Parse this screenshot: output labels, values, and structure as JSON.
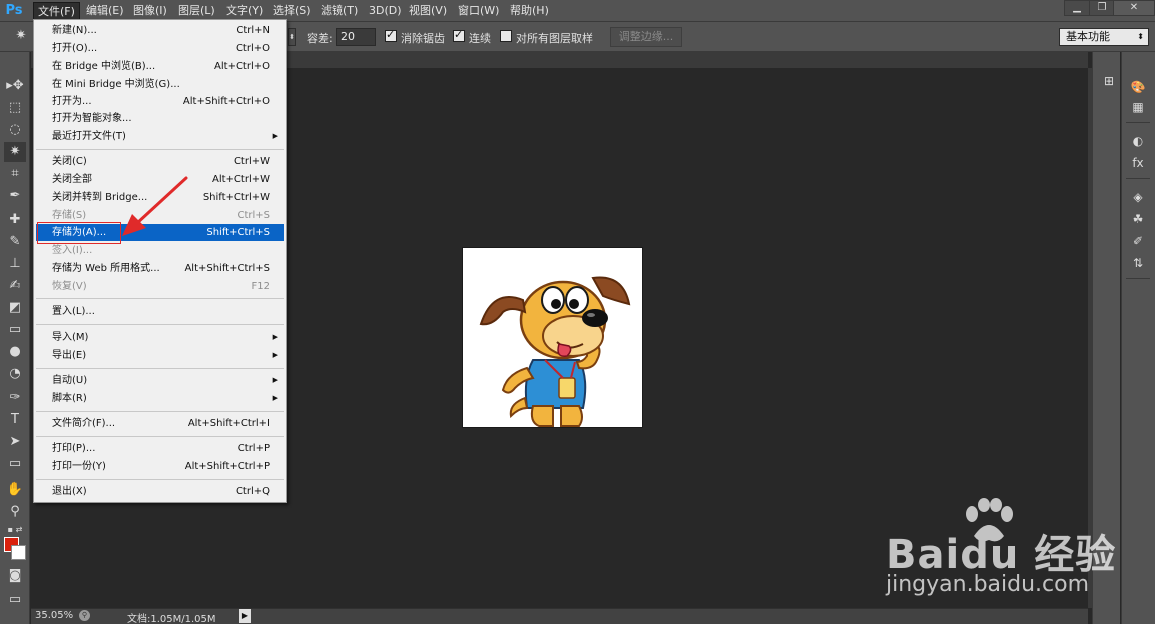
{
  "app": {
    "logo": "Ps"
  },
  "menubar": {
    "items": [
      "文件(F)",
      "编辑(E)",
      "图像(I)",
      "图层(L)",
      "文字(Y)",
      "选择(S)",
      "滤镜(T)",
      "3D(D)",
      "视图(V)",
      "窗口(W)",
      "帮助(H)"
    ],
    "active_index": 0,
    "window_controls": {
      "minimize": "▁",
      "restore": "❐",
      "close": "✕"
    }
  },
  "options": {
    "tolerance_label": "容差:",
    "tolerance_value": "20",
    "antialias_label": "消除锯齿",
    "antialias_checked": true,
    "contiguous_label": "连续",
    "contiguous_checked": true,
    "sample_all_layers_label": "对所有图层取样",
    "sample_all_layers_checked": false,
    "refine_edge_button": "调整边缘...",
    "workspace": "基本功能"
  },
  "file_menu": {
    "items": [
      {
        "label": "新建(N)...",
        "shortcut": "Ctrl+N"
      },
      {
        "label": "打开(O)...",
        "shortcut": "Ctrl+O"
      },
      {
        "label": "在 Bridge 中浏览(B)...",
        "shortcut": "Alt+Ctrl+O"
      },
      {
        "label": "在 Mini Bridge 中浏览(G)...",
        "shortcut": ""
      },
      {
        "label": "打开为...",
        "shortcut": "Alt+Shift+Ctrl+O"
      },
      {
        "label": "打开为智能对象...",
        "shortcut": ""
      },
      {
        "label": "最近打开文件(T)",
        "shortcut": "",
        "submenu": true
      },
      {
        "label": "关闭(C)",
        "shortcut": "Ctrl+W"
      },
      {
        "label": "关闭全部",
        "shortcut": "Alt+Ctrl+W"
      },
      {
        "label": "关闭并转到 Bridge...",
        "shortcut": "Shift+Ctrl+W"
      },
      {
        "label": "存储(S)",
        "shortcut": "Ctrl+S",
        "disabled": true
      },
      {
        "label": "存储为(A)...",
        "shortcut": "Shift+Ctrl+S",
        "highlighted": true
      },
      {
        "label": "签入(I)...",
        "shortcut": "",
        "disabled": true
      },
      {
        "label": "存储为 Web 所用格式...",
        "shortcut": "Alt+Shift+Ctrl+S"
      },
      {
        "label": "恢复(V)",
        "shortcut": "F12",
        "disabled": true
      },
      {
        "label": "置入(L)...",
        "shortcut": ""
      },
      {
        "label": "导入(M)",
        "shortcut": "",
        "submenu": true
      },
      {
        "label": "导出(E)",
        "shortcut": "",
        "submenu": true
      },
      {
        "label": "自动(U)",
        "shortcut": "",
        "submenu": true
      },
      {
        "label": "脚本(R)",
        "shortcut": "",
        "submenu": true
      },
      {
        "label": "文件简介(F)...",
        "shortcut": "Alt+Shift+Ctrl+I"
      },
      {
        "label": "打印(P)...",
        "shortcut": "Ctrl+P"
      },
      {
        "label": "打印一份(Y)",
        "shortcut": "Alt+Shift+Ctrl+P"
      },
      {
        "label": "退出(X)",
        "shortcut": "Ctrl+Q"
      }
    ]
  },
  "status": {
    "zoom": "35.05%",
    "doc_info": "文档:1.05M/1.05M"
  },
  "colors": {
    "foreground": "#d9210d",
    "background": "#ffffff",
    "highlight": "#0a64c6",
    "annotation": "#e02a2a"
  },
  "watermark": {
    "brand": "Baidu 经验",
    "url": "jingyan.baidu.com"
  }
}
